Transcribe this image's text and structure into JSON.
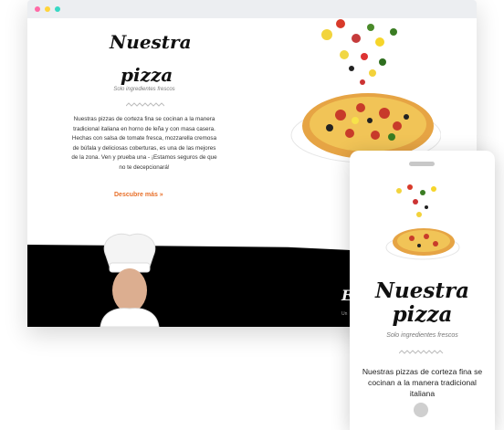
{
  "desktop": {
    "title_line1": "Nuestra",
    "title_line2": "pizza",
    "subtitle": "Solo ingredientes frescos",
    "body": "Nuestras pizzas de corteza fina se cocinan a la manera tradicional italiana en horno de leña y con masa casera. Hechas con salsa de tomate fresca, mozzarella cremosa de búfala y deliciosas coberturas, es una de las mejores de la zona. Ven y prueba una - ¡Estamos seguros de que no te decepcionará!",
    "cta": "Descubre más »",
    "dark_title": "E",
    "dark_sub": "Un"
  },
  "phone": {
    "title_line1": "Nuestra",
    "title_line2": "pizza",
    "subtitle": "Solo ingredientes frescos",
    "body": "Nuestras pizzas de corteza fina se cocinan a la manera tradicional italiana"
  }
}
